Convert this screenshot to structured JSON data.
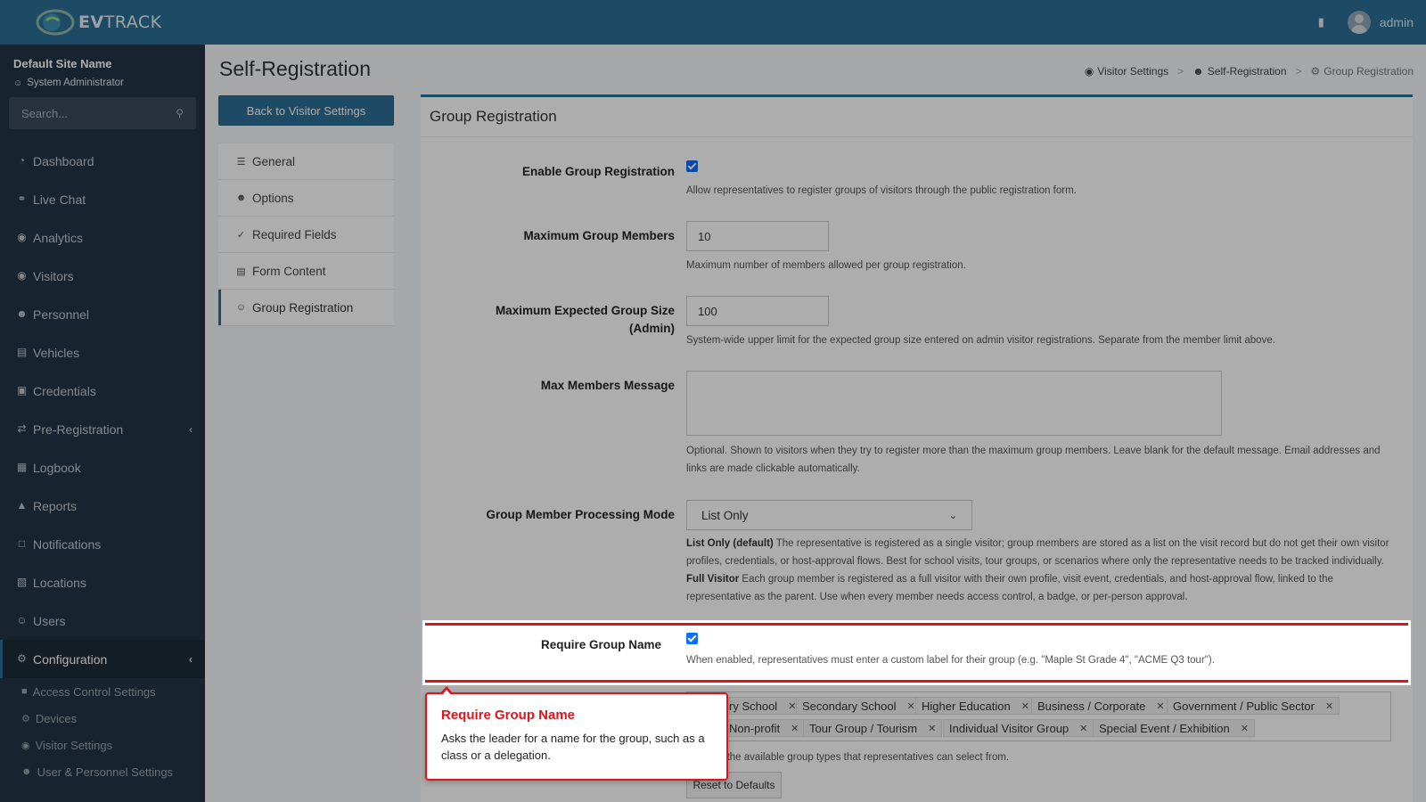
{
  "brand": {
    "name_bold": "EV",
    "name_rest": "TRACK"
  },
  "topbar": {
    "user": "admin"
  },
  "sidebar": {
    "site_name": "Default Site Name",
    "role": "System Administrator",
    "search_placeholder": "Search...",
    "items": [
      {
        "label": "Dashboard",
        "icon": "gauge-icon"
      },
      {
        "label": "Live Chat",
        "icon": "headset-icon"
      },
      {
        "label": "Analytics",
        "icon": "target-icon"
      },
      {
        "label": "Visitors",
        "icon": "eye-icon"
      },
      {
        "label": "Personnel",
        "icon": "user-gear-icon"
      },
      {
        "label": "Vehicles",
        "icon": "car-icon"
      },
      {
        "label": "Credentials",
        "icon": "badge-icon"
      },
      {
        "label": "Pre-Registration",
        "icon": "arrows-icon"
      },
      {
        "label": "Logbook",
        "icon": "book-icon"
      },
      {
        "label": "Reports",
        "icon": "chart-icon"
      },
      {
        "label": "Notifications",
        "icon": "comment-icon"
      },
      {
        "label": "Locations",
        "icon": "building-icon"
      },
      {
        "label": "Users",
        "icon": "users-icon"
      },
      {
        "label": "Configuration",
        "icon": "gear-icon"
      }
    ],
    "sub_items": [
      {
        "label": "Access Control Settings",
        "icon": "lock-icon"
      },
      {
        "label": "Devices",
        "icon": "gear-icon"
      },
      {
        "label": "Visitor Settings",
        "icon": "eye-icon"
      },
      {
        "label": "User & Personnel Settings",
        "icon": "user-gear-icon"
      }
    ]
  },
  "page": {
    "title": "Self-Registration",
    "breadcrumb": [
      "Visitor Settings",
      "Self-Registration",
      "Group Registration"
    ],
    "back_button": "Back to Visitor Settings"
  },
  "subnav": [
    {
      "label": "General",
      "icon": "sliders-icon"
    },
    {
      "label": "Options",
      "icon": "user-gear-icon"
    },
    {
      "label": "Required Fields",
      "icon": "list-check-icon"
    },
    {
      "label": "Form Content",
      "icon": "form-icon"
    },
    {
      "label": "Group Registration",
      "icon": "people-group-icon"
    }
  ],
  "form": {
    "header": "Group Registration",
    "enable_group": {
      "label": "Enable Group Registration",
      "checked": true,
      "help": "Allow representatives to register groups of visitors through the public registration form."
    },
    "max_members": {
      "label": "Maximum Group Members",
      "value": "10",
      "help": "Maximum number of members allowed per group registration."
    },
    "max_expected": {
      "label": "Maximum Expected Group Size (Admin)",
      "value": "100",
      "help": "System-wide upper limit for the expected group size entered on admin visitor registrations. Separate from the member limit above."
    },
    "max_message": {
      "label": "Max Members Message",
      "value": "",
      "help": "Optional. Shown to visitors when they try to register more than the maximum group members. Leave blank for the default message. Email addresses and links are made clickable automatically."
    },
    "processing_mode": {
      "label": "Group Member Processing Mode",
      "selected": "List Only",
      "help_list_title": "List Only (default)",
      "help_list": "The representative is registered as a single visitor; group members are stored as a list on the visit record but do not get their own visitor profiles, credentials, or host-approval flows. Best for school visits, tour groups, or scenarios where only the representative needs to be tracked individually.",
      "help_full_title": "Full Visitor",
      "help_full": "Each group member is registered as a full visitor with their own profile, visit event, credentials, and host-approval flow, linked to the representative as the parent. Use when every member needs access control, a badge, or per-person approval."
    },
    "require_name": {
      "label": "Require Group Name",
      "checked": true,
      "help": "When enabled, representatives must enter a custom label for their group (e.g. \"Maple St Grade 4\", \"ACME Q3 tour\")."
    },
    "group_types": {
      "tags_row1": [
        "ry School",
        "Secondary School",
        "Higher Education",
        "Business / Corporate",
        "Government / Public Sector"
      ],
      "tags_row2": [
        "Non-profit",
        "Tour Group / Tourism",
        "Individual Visitor Group",
        "Special Event / Exhibition"
      ],
      "help_partial": "e the available group types that representatives can select from.",
      "reset_button": "Reset to Defaults"
    }
  },
  "tooltip": {
    "title": "Require Group Name",
    "body": "Asks the leader for a name for the group, such as a class or a delegation."
  },
  "colors": {
    "primary": "#2b6d94",
    "sidebar": "#233646",
    "highlight": "#e0141b"
  }
}
